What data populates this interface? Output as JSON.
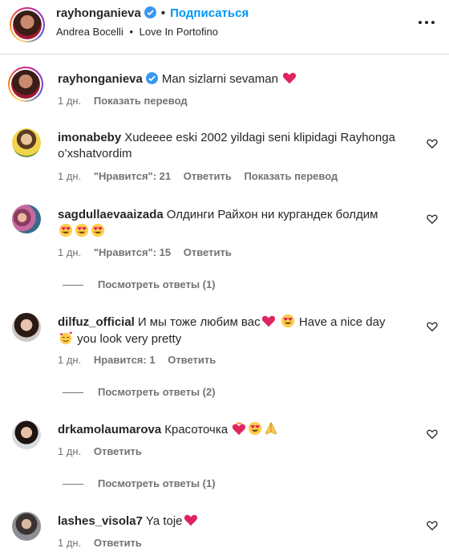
{
  "header": {
    "username": "rayhonganieva",
    "follow_label": "Подписаться",
    "song_artist": "Andrea Bocelli",
    "song_title": "Love In Portofino",
    "separator": "•",
    "more_icon": "more-horizontal-icon"
  },
  "caption": {
    "username": "rayhonganieva",
    "text": "Man sizlarni sevaman",
    "time": "1 дн.",
    "translate_label": "Показать перевод"
  },
  "comments": [
    {
      "username": "imonabeby",
      "text": "Xudeeee eski 2002 yildagi seni klipidagi Rayhonga o’xshatvordim",
      "time": "1 дн.",
      "likes_label": "\"Нравится\": 21",
      "reply_label": "Ответить",
      "translate_label": "Показать перевод"
    },
    {
      "username": "sagdullaevaaizada",
      "text": "Олдинги Райхон ни кургандек болдим",
      "time": "1 дн.",
      "likes_label": "\"Нравится\": 15",
      "reply_label": "Ответить",
      "view_replies": "Посмотреть ответы (1)"
    },
    {
      "username": "dilfuz_official",
      "text_a": "И мы тоже любим вас",
      "text_b": "Have a nice day",
      "text_c": "you look very pretty",
      "time": "1 дн.",
      "likes_label": "Нравится: 1",
      "reply_label": "Ответить",
      "view_replies": "Посмотреть ответы (2)"
    },
    {
      "username": "drkamolaumarova",
      "text": "Красоточка",
      "time": "1 дн.",
      "reply_label": "Ответить",
      "view_replies": "Посмотреть ответы (1)"
    },
    {
      "username": "lashes_visola7",
      "text": "Ya toje",
      "time": "1 дн.",
      "reply_label": "Ответить"
    }
  ],
  "colors": {
    "link_blue": "#0095f6",
    "verified_blue": "#3897f0",
    "meta_gray": "#737373",
    "heart_red": "#e0245e"
  }
}
